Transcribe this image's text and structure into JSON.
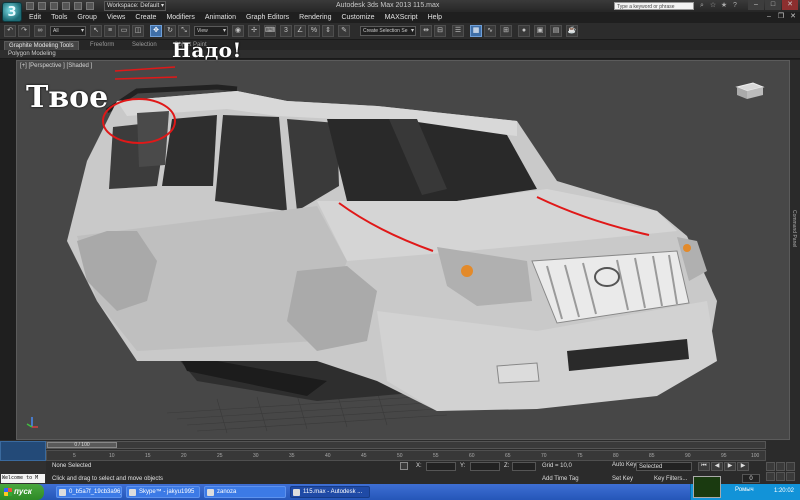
{
  "titlebar": {
    "workspace": "Workspace: Default",
    "title": "Autodesk 3ds Max 2013     115.max",
    "search_placeholder": "Type a keyword or phrase"
  },
  "menu": [
    "Edit",
    "Tools",
    "Group",
    "Views",
    "Create",
    "Modifiers",
    "Animation",
    "Graph Editors",
    "Rendering",
    "Customize",
    "MAXScript",
    "Help"
  ],
  "toolbar": {
    "selection_filter": "All",
    "ref_coord": "View",
    "named_selection": "Create Selection Se"
  },
  "ribbon": {
    "tabs": [
      "Graphite Modeling Tools",
      "Freeform",
      "Selection",
      "Object Paint"
    ],
    "panel": "Polygon Modeling"
  },
  "viewport": {
    "label": "[+] [Perspective ] [Shaded ]",
    "right_panel": "Command Panel"
  },
  "annotations": {
    "nado": "Надо!",
    "tvoe": "Твое"
  },
  "timeline": {
    "frame": "0 / 100",
    "ticks": [
      "5",
      "10",
      "15",
      "20",
      "25",
      "30",
      "35",
      "40",
      "45",
      "50",
      "55",
      "60",
      "65",
      "70",
      "75",
      "80",
      "85",
      "90",
      "95",
      "100"
    ]
  },
  "status": {
    "selection": "None Selected",
    "prompt": "Click and drag to select and move objects",
    "maxscript": "Welcome to M",
    "x_label": "X:",
    "y_label": "Y:",
    "z_label": "Z:",
    "grid": "Grid = 10,0",
    "add_time_tag": "Add Time Tag",
    "auto_key": "Auto Key",
    "selected": "Selected",
    "set_key": "Set Key",
    "key_filters": "Key Filters...",
    "current_frame": "0"
  },
  "taskbar": {
    "start": "пуск",
    "tasks": [
      "0_b5a7f_19cb3a96_...",
      "Skype™ - jakyu1995",
      "zanoza",
      "115.max - Autodesk ..."
    ],
    "user": "Ромыч",
    "time": "1:20:02"
  }
}
